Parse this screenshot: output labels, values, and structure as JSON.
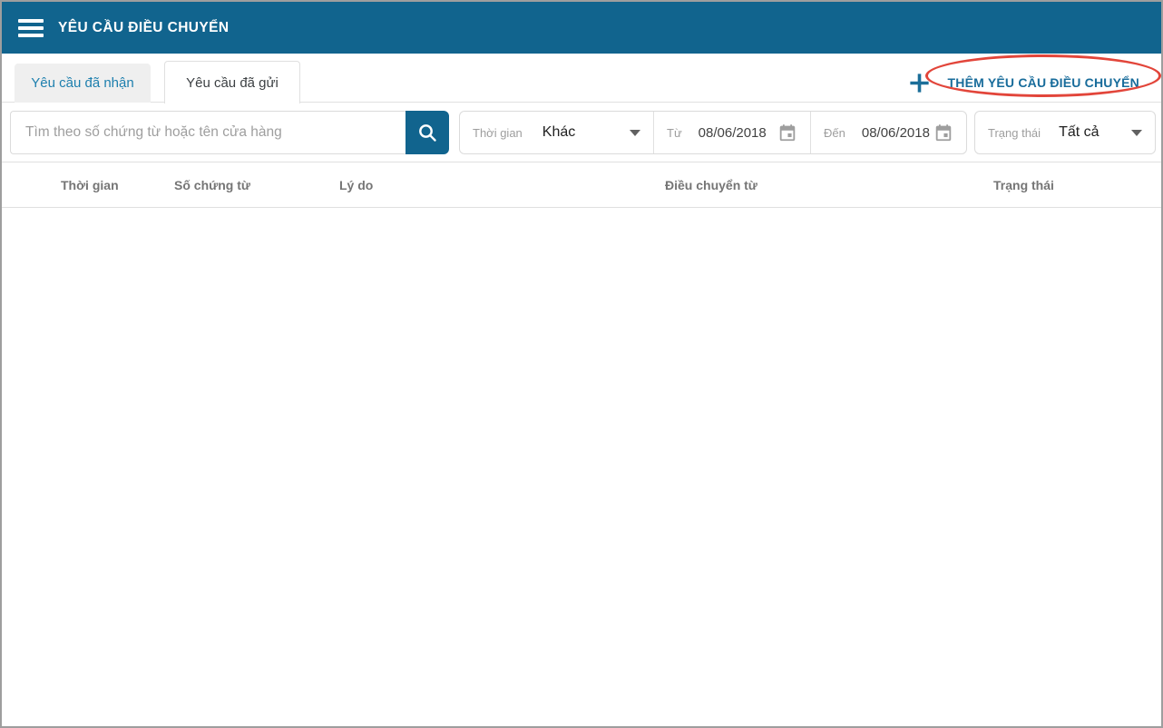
{
  "header": {
    "title": "YÊU CẦU ĐIỀU CHUYỂN"
  },
  "tabs": {
    "received": {
      "label": "Yêu cầu đã nhận",
      "active": false
    },
    "sent": {
      "label": "Yêu cầu đã gửi",
      "active": true
    }
  },
  "add_button": {
    "label": "THÊM YÊU CẦU ĐIỀU CHUYỂN",
    "annotated": true
  },
  "search": {
    "placeholder": "Tìm theo số chứng từ hoặc tên cửa hàng",
    "value": ""
  },
  "filters": {
    "time": {
      "label": "Thời gian",
      "value": "Khác"
    },
    "from": {
      "label": "Từ",
      "value": "08/06/2018"
    },
    "to": {
      "label": "Đến",
      "value": "08/06/2018"
    },
    "status": {
      "label": "Trạng thái",
      "value": "Tất cả"
    }
  },
  "table": {
    "columns": [
      "Thời gian",
      "Số chứng từ",
      "Lý do",
      "Điều chuyển từ",
      "Trạng thái"
    ],
    "rows": []
  },
  "icons": {
    "menu": "hamburger three white bars",
    "search": "white magnifier glyph",
    "add": "thick blue plus cross",
    "calendar": "gray outline calendar with filled day square",
    "dropdown": "dark gray triangle pointing down"
  },
  "colors": {
    "primary": "#11648E",
    "tab_link_blue": "#1D7FAE",
    "add_button_blue": "#186C9B",
    "annotation_red": "#E2453A",
    "border_light": "#E0E0E0",
    "label_gray": "#9E9E9E",
    "header_text_gray": "#757575"
  }
}
